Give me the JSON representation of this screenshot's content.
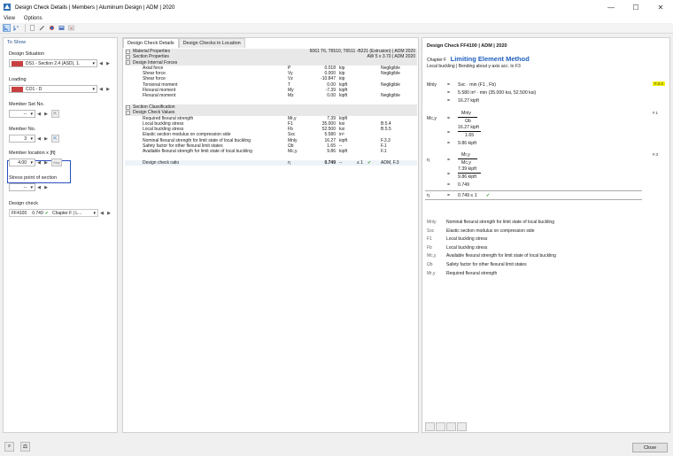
{
  "window": {
    "title": "Design Check Details | Members | Aluminum Design | ADM | 2020",
    "minimize": "—",
    "maximize": "☐",
    "close": "✕"
  },
  "menu": {
    "items": [
      "View",
      "Options"
    ]
  },
  "left": {
    "header": "To Show",
    "design_situation_label": "Design Situation",
    "design_situation_value": "DS1 - Section 2.4 (ASD), 1.",
    "loading_label": "Loading",
    "loading_value": "CO1 - D",
    "member_set_label": "Member Set No.",
    "member_set_value": "--",
    "member_label": "Member No.",
    "member_value": "3",
    "location_label": "Member location x [ft]",
    "location_value": "4.00",
    "location_unit_btn": "Mxy",
    "stress_point_label": "Stress point of section",
    "stress_point_value": "--",
    "design_check_label": "Design check",
    "design_check_id": "FF4100",
    "design_check_ratio": "0.749",
    "design_check_desc": "Chapter F | L..."
  },
  "mid": {
    "tabs": [
      "Design Check Details",
      "Design Checks in Location"
    ],
    "rows": [
      {
        "type": "sect",
        "label": "Material Properties",
        "right": "6061 T6, T6510, T6511 -B221 (Extrusion) | ADM 2020"
      },
      {
        "type": "sect",
        "label": "Section Properties",
        "right": "AW 5 x 3.70 | ADM 2020"
      },
      {
        "type": "sect",
        "label": "Design Internal Forces",
        "right": ""
      },
      {
        "type": "data",
        "label": "Axial force",
        "sym": "P",
        "val": "0.018",
        "unit": "kip",
        "ref": "Negligible"
      },
      {
        "type": "data",
        "label": "Shear force",
        "sym": "Vy",
        "val": "0.000",
        "unit": "kip",
        "ref": "Negligible"
      },
      {
        "type": "data",
        "label": "Shear force",
        "sym": "Vz",
        "val": "-10.847",
        "unit": "kip",
        "ref": ""
      },
      {
        "type": "data",
        "label": "Torsional moment",
        "sym": "T",
        "val": "0.00",
        "unit": "kipft",
        "ref": "Negligible"
      },
      {
        "type": "data",
        "label": "Flexural moment",
        "sym": "My",
        "val": "-7.39",
        "unit": "kipft",
        "ref": ""
      },
      {
        "type": "data",
        "label": "Flexural moment",
        "sym": "Mz",
        "val": "0.00",
        "unit": "kipft",
        "ref": "Negligible"
      },
      {
        "type": "blank"
      },
      {
        "type": "sect",
        "label": "Section Classification",
        "right": ""
      },
      {
        "type": "sect",
        "label": "Design Check Values",
        "right": ""
      },
      {
        "type": "data",
        "label": "Required flexural strength",
        "sym": "Mr,y",
        "val": "7.39",
        "unit": "kipft",
        "ref": ""
      },
      {
        "type": "data",
        "label": "Local buckling stress",
        "sym": "F1",
        "val": "35.000",
        "unit": "ksi",
        "ref": "B.5.4"
      },
      {
        "type": "data",
        "label": "Local buckling stress",
        "sym": "Fb",
        "val": "52.500",
        "unit": "ksi",
        "ref": "B.5.5"
      },
      {
        "type": "data",
        "label": "Elastic section modulus on compression side",
        "sym": "Sxc",
        "val": "5.580",
        "unit": "in³",
        "ref": ""
      },
      {
        "type": "data",
        "label": "Nominal flexural strength for limit state of local buckling",
        "sym": "Mnly",
        "val": "16.27",
        "unit": "kipft",
        "ref": "F.3.3"
      },
      {
        "type": "data",
        "label": "Safety factor for other flexural limit states",
        "sym": "Ωb",
        "val": "1.65",
        "unit": "--",
        "ref": "F.1"
      },
      {
        "type": "data",
        "label": "Available flexural strength for limit state of local buckling",
        "sym": "Mc,y",
        "val": "9.86",
        "unit": "kipft",
        "ref": "F.1"
      },
      {
        "type": "blank"
      },
      {
        "type": "ratio",
        "label": "Design check ratio",
        "sym": "η",
        "val": "0.749",
        "unit": "--",
        "lim": "≤ 1",
        "ref": "ADM, F.3"
      }
    ]
  },
  "right": {
    "heading": "Design Check FF4100 | ADM | 2020",
    "chapter": "Chapter F",
    "method": "Limiting Element Method",
    "subtitle": "Local buckling | Bending about y-axis acc. to F3",
    "eq1_lhs": "Mnly",
    "eq1_a": "Sxc · min (F1 , Fb)",
    "eq1_b": "5.580 in³ · min (35.000 ksi, 52.500 ksi)",
    "eq1_c": "16.27 kipft",
    "ref1": "F.3.3",
    "eq2_lhs": "Mc,y",
    "eq2_num": "Mnly",
    "eq2_den": "Ωb",
    "eq2_num2": "16.27 kipft",
    "eq2_den2": "1.65",
    "eq2_c": "9.86 kipft",
    "ref2": "F.1",
    "eq3_lhs": "η",
    "eq3_num": "Mr,y",
    "eq3_den": "Mc,y",
    "eq3_num2": "7.39 kipft",
    "eq3_den2": "9.86 kipft",
    "eq3_c": "0.749",
    "ref3": "F.3",
    "final_lhs": "η",
    "final_val": "0.749 ≤ 1",
    "legend": [
      {
        "sym": "Mnly",
        "desc": "Nominal flexural strength for limit state of local buckling"
      },
      {
        "sym": "Sxc",
        "desc": "Elastic section modulus on compression side"
      },
      {
        "sym": "F1",
        "desc": "Local buckling stress"
      },
      {
        "sym": "Fb",
        "desc": "Local buckling stress"
      },
      {
        "sym": "Mc,y",
        "desc": "Available flexural strength for limit state of local buckling"
      },
      {
        "sym": "Ωb",
        "desc": "Safety factor for other flexural limit states"
      },
      {
        "sym": "Mr,y",
        "desc": "Required flexural strength"
      }
    ]
  },
  "footer": {
    "close_label": "Close"
  },
  "colors": {
    "accent": "#1f5fbf",
    "highlight": "#2a4fbf",
    "tag": "#c94040",
    "ok": "#2a9a2a",
    "ref_mark": "#f4f000"
  }
}
